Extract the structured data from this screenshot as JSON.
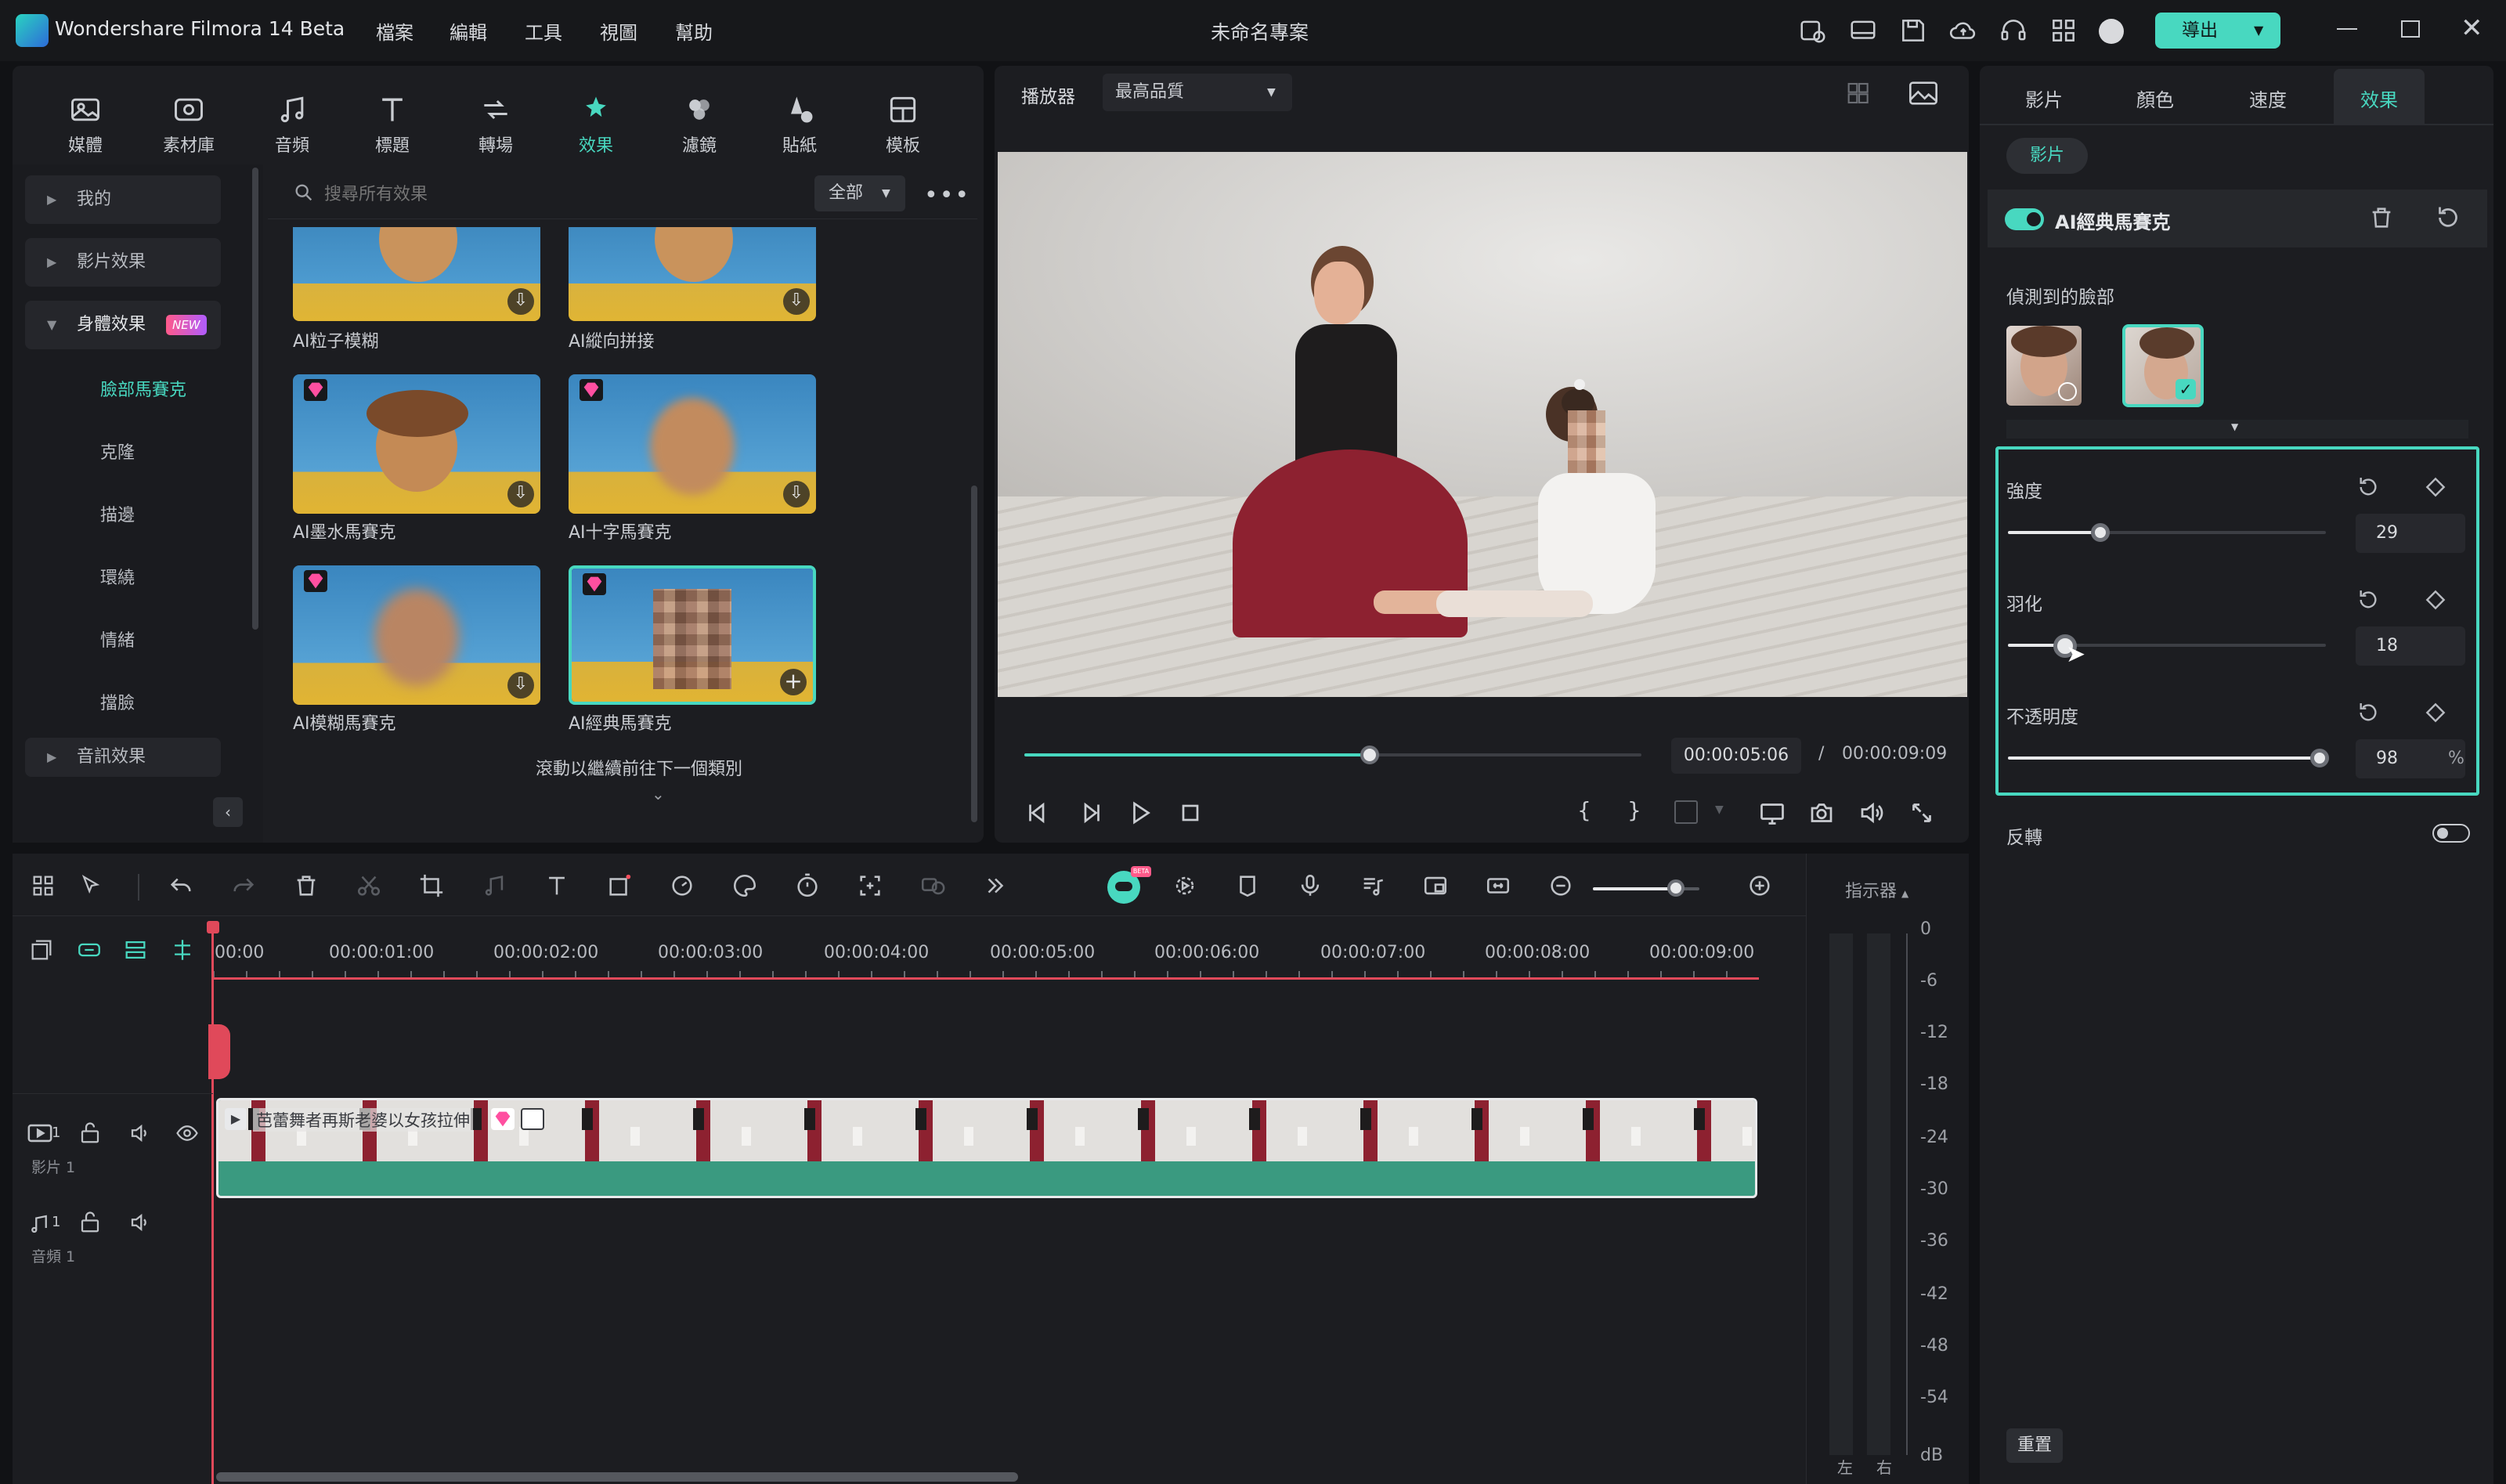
{
  "app": {
    "title": "Wondershare Filmora 14 Beta",
    "project_name": "未命名專案",
    "export_label": "導出"
  },
  "menu": [
    "檔案",
    "編輯",
    "工具",
    "視圖",
    "幫助"
  ],
  "media_tabs": [
    {
      "label": "媒體",
      "icon": "media-icon"
    },
    {
      "label": "素材庫",
      "icon": "library-icon"
    },
    {
      "label": "音頻",
      "icon": "music-icon"
    },
    {
      "label": "標題",
      "icon": "title-icon"
    },
    {
      "label": "轉場",
      "icon": "transition-icon"
    },
    {
      "label": "效果",
      "icon": "effects-icon",
      "active": true
    },
    {
      "label": "濾鏡",
      "icon": "filter-icon"
    },
    {
      "label": "貼紙",
      "icon": "sticker-icon"
    },
    {
      "label": "模板",
      "icon": "template-icon"
    }
  ],
  "sidebar": {
    "items": [
      {
        "label": "我的"
      },
      {
        "label": "影片效果"
      },
      {
        "label": "身體效果",
        "badge": "NEW",
        "expanded": true
      },
      {
        "label": "音訊效果"
      }
    ],
    "sub_items": [
      "臉部馬賽克",
      "克隆",
      "描邊",
      "環繞",
      "情緒",
      "擋臉"
    ],
    "active_sub": "臉部馬賽克"
  },
  "search": {
    "placeholder": "搜尋所有效果",
    "filter": "全部"
  },
  "effects": [
    {
      "label": "AI粒子模糊"
    },
    {
      "label": "AI縱向拼接"
    },
    {
      "label": "AI墨水馬賽克"
    },
    {
      "label": "AI十字馬賽克"
    },
    {
      "label": "AI模糊馬賽克"
    },
    {
      "label": "AI經典馬賽克",
      "selected": true
    }
  ],
  "scroll_hint": "滾動以繼續前往下一個類別",
  "player": {
    "label": "播放器",
    "quality": "最高品質",
    "current_time": "00:00:05:06",
    "separator": "/",
    "total_time": "00:00:09:09",
    "progress": 0.56
  },
  "props": {
    "tabs": [
      "影片",
      "顏色",
      "速度",
      "效果"
    ],
    "active_tab": "效果",
    "chip": "影片",
    "effect_name": "AI經典馬賽克",
    "faces_label": "偵測到的臉部",
    "params": [
      {
        "label": "強度",
        "value": "29",
        "fraction": 0.29
      },
      {
        "label": "羽化",
        "value": "18",
        "fraction": 0.18
      },
      {
        "label": "不透明度",
        "value": "98",
        "unit": "%",
        "fraction": 0.98
      }
    ],
    "invert_label": "反轉",
    "reset_label": "重置"
  },
  "timeline": {
    "ruler": [
      "00:00",
      "00:00:01:00",
      "00:00:02:00",
      "00:00:03:00",
      "00:00:04:00",
      "00:00:05:00",
      "00:00:06:00",
      "00:00:07:00",
      "00:00:08:00",
      "00:00:09:00"
    ],
    "clip_name": "芭蕾舞者再斯老婆以女孩拉伸",
    "video_track": "影片 1",
    "audio_track": "音頻 1",
    "track_num": "1",
    "indicator": "指示器",
    "db_scale": [
      "0",
      "-6",
      "-12",
      "-18",
      "-24",
      "-30",
      "-36",
      "-42",
      "-48",
      "-54"
    ],
    "db_unit": "dB",
    "left": "左",
    "right": "右",
    "zoom": 0.78
  },
  "colors": {
    "accent": "#48d8c0",
    "export_bg": "#48d8c0",
    "clip_bg": "#3a9a80"
  }
}
